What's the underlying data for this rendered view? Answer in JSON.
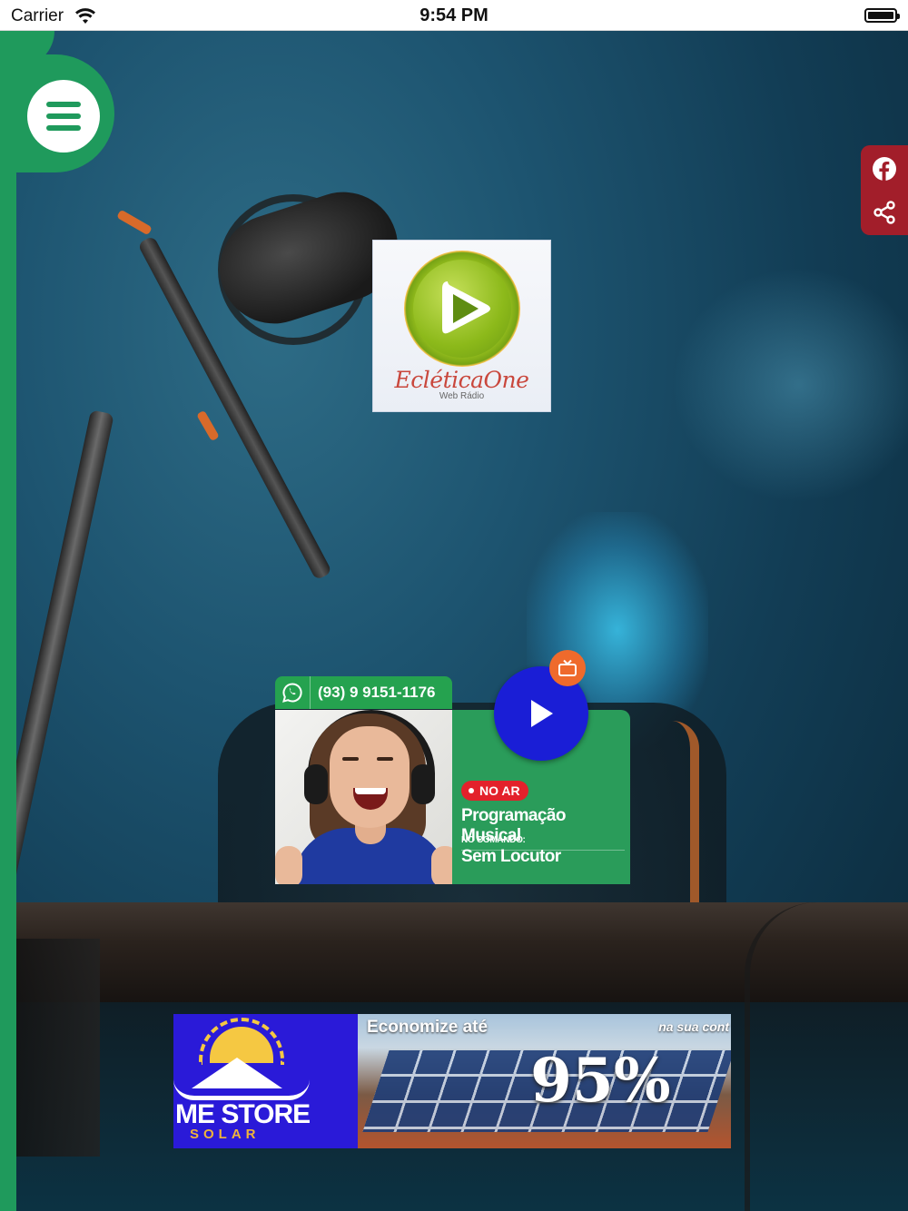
{
  "status_bar": {
    "carrier": "Carrier",
    "time": "9:54 PM"
  },
  "logo": {
    "name": "EcléticaOne",
    "subtitle": "Web Rádio"
  },
  "player": {
    "whatsapp_number": "(93) 9 9151-1176",
    "live_badge": "NO AR",
    "program": "Programação Musical",
    "host_label": "NO COMANDO:",
    "host": "Sem Locutor"
  },
  "ad": {
    "brand": "ME STORE",
    "brand_sub": "SOLAR",
    "headline": "Economize até",
    "tag": "na sua cont",
    "percent": "95%"
  },
  "icons": {
    "menu": "hamburger-menu-icon",
    "facebook": "facebook-icon",
    "share": "share-icon",
    "whatsapp": "whatsapp-icon",
    "play": "play-icon",
    "tv": "tv-icon"
  },
  "colors": {
    "brand_green": "#1f9a5c",
    "player_green": "#2a9c5a",
    "play_blue": "#1a1ed6",
    "social_red": "#a21e2a",
    "live_red": "#e3212b",
    "tv_orange": "#ef6a2c"
  }
}
